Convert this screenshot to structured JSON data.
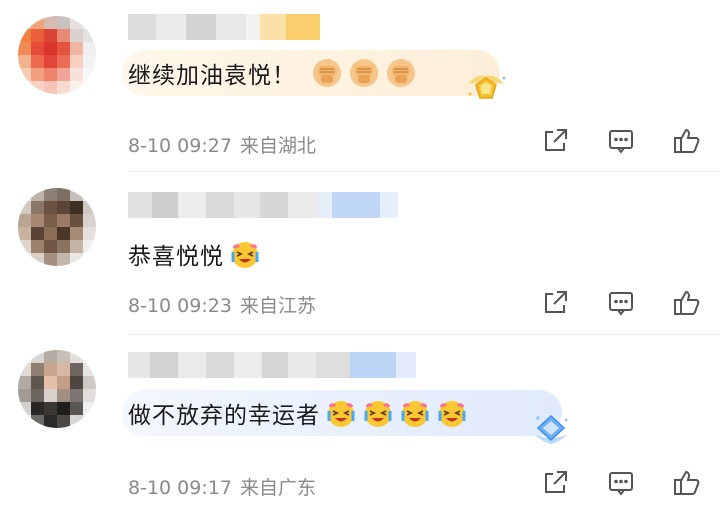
{
  "comments": [
    {
      "text": "继续加油袁悦！",
      "emoji": "fist-emoji",
      "emoji_count": 3,
      "badge": "gold-medal-icon",
      "date": "8-10",
      "time": "09:27",
      "location": "来自湖北",
      "bubble_color": "#fdf3e3"
    },
    {
      "text": "恭喜悦悦",
      "emoji": "crying-laugh-emoji",
      "emoji_count": 1,
      "badge": "",
      "date": "8-10",
      "time": "09:23",
      "location": "来自江苏",
      "bubble_color": "#ffffff"
    },
    {
      "text": "做不放弃的幸运者",
      "emoji": "crying-laugh-emoji",
      "emoji_count": 4,
      "badge": "blue-diamond-icon",
      "date": "8-10",
      "time": "09:17",
      "location": "来自广东",
      "bubble_color": "#e9f1fd"
    }
  ],
  "actions": [
    "share-icon",
    "comment-icon",
    "like-icon"
  ]
}
